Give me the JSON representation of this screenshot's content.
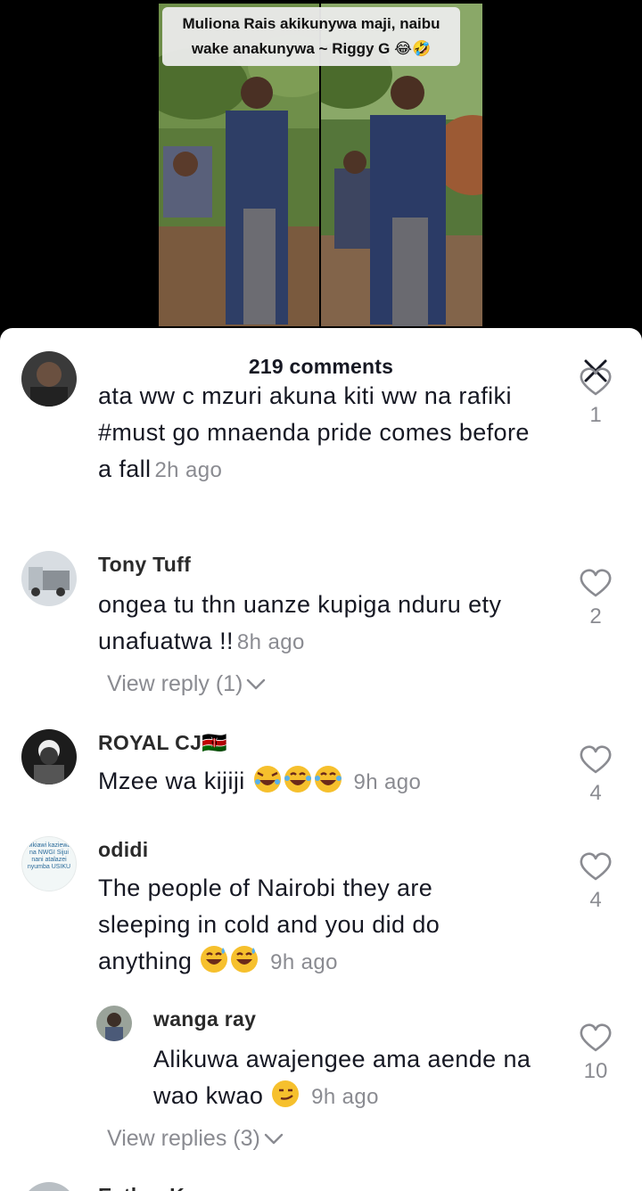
{
  "video": {
    "caption": "Muliona Rais akikunywa maji, naibu\nwake anakunywa ~ Riggy G 😂🤣"
  },
  "sheet": {
    "title": "219 comments"
  },
  "comments": [
    {
      "user": "",
      "text": "ata ww c mzuri akuna kiti ww na rafiki #must go mnaenda pride comes before a fall",
      "time": "2h ago",
      "likes": "1"
    },
    {
      "user": "Tony Tuff",
      "text": "ongea tu thn uanze kupiga nduru ety unafuatwa !!",
      "time": "8h ago",
      "likes": "2",
      "replies_label": "View reply (1)"
    },
    {
      "user": "ROYAL CJ🇰🇪",
      "text": "Mzee wa kijiji",
      "time": "9h ago",
      "likes": "4"
    },
    {
      "user": "odidi",
      "avatar_text": "Mkiawi kaziewa na NWGI Sijui nani atalazei nyumba USIKU",
      "text": "The people of Nairobi they are sleeping in cold and you did do anything",
      "time": "9h ago",
      "likes": "4"
    },
    {
      "user": "wanga ray",
      "text": "Alikuwa awajengee ama aende na wao kwao",
      "time": "9h ago",
      "likes": "10",
      "replies_label": "View replies (3)"
    },
    {
      "user": "Esther K"
    }
  ],
  "icons": {
    "close": "close-icon",
    "heart": "heart-outline-icon",
    "chevron": "chevron-down-icon"
  },
  "colors": {
    "muted": "#8a8b91",
    "text": "#161823",
    "sheet_bg": "#ffffff"
  }
}
